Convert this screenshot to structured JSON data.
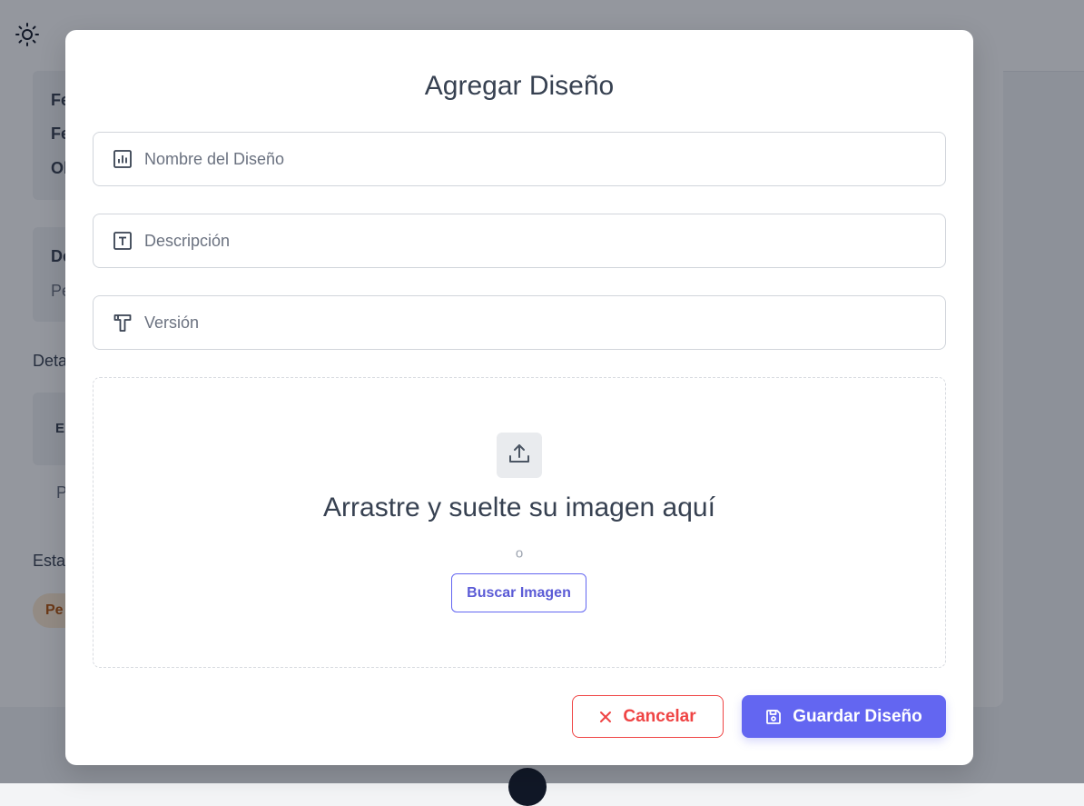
{
  "background": {
    "rows": [
      {
        "text": "Fe",
        "style": "bold"
      },
      {
        "text": "Fe",
        "style": "bold"
      },
      {
        "text": "Ol",
        "style": "bold"
      }
    ],
    "box2_title": "De",
    "box2_value": "Pe",
    "section1": "Deta",
    "table_header": "E",
    "table_value": "P",
    "section2": "Esta",
    "badge": "Pe"
  },
  "modal": {
    "title": "Agregar Diseño",
    "fields": {
      "name": {
        "placeholder": "Nombre del Diseño",
        "value": "",
        "icon": "chart-icon"
      },
      "description": {
        "placeholder": "Descripción",
        "value": "",
        "icon": "text-box-icon"
      },
      "version": {
        "placeholder": "Versión",
        "value": "",
        "icon": "typography-icon"
      }
    },
    "dropzone": {
      "icon": "upload-icon",
      "title": "Arrastre y suelte su imagen aquí",
      "or": "o",
      "browse_label": "Buscar Imagen"
    },
    "actions": {
      "cancel_label": "Cancelar",
      "cancel_icon": "close-icon",
      "save_label": "Guardar Diseño",
      "save_icon": "save-icon"
    }
  },
  "colors": {
    "primary": "#6366f1",
    "danger": "#ef4444",
    "text": "#374151",
    "border": "#d1d5db"
  }
}
